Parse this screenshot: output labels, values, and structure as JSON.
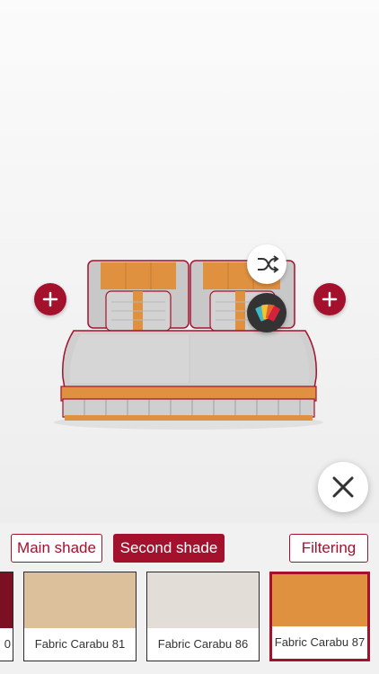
{
  "toolbar": {
    "main_shade_label": "Main shade",
    "second_shade_label": "Second shade",
    "filtering_label": "Filtering",
    "active_tab": "Second shade"
  },
  "swatches": [
    {
      "name": "0",
      "color": "#7a1022",
      "partial": true
    },
    {
      "name": "Fabric Carabu 81",
      "color": "#dcc09c"
    },
    {
      "name": "Fabric Carabu 86",
      "color": "#e3ddd7"
    },
    {
      "name": "Fabric Carabu 87",
      "color": "#e0913f",
      "selected": true
    }
  ],
  "sofa": {
    "main_color": "#c9c9c9",
    "second_color": "#e0913f",
    "outline_color": "#a3112d"
  },
  "icons": {
    "add_left": "plus-icon",
    "add_right": "plus-icon",
    "shuffle": "shuffle-icon",
    "palette": "color-palette-icon",
    "close": "close-icon"
  },
  "colors": {
    "accent": "#a3112d"
  }
}
